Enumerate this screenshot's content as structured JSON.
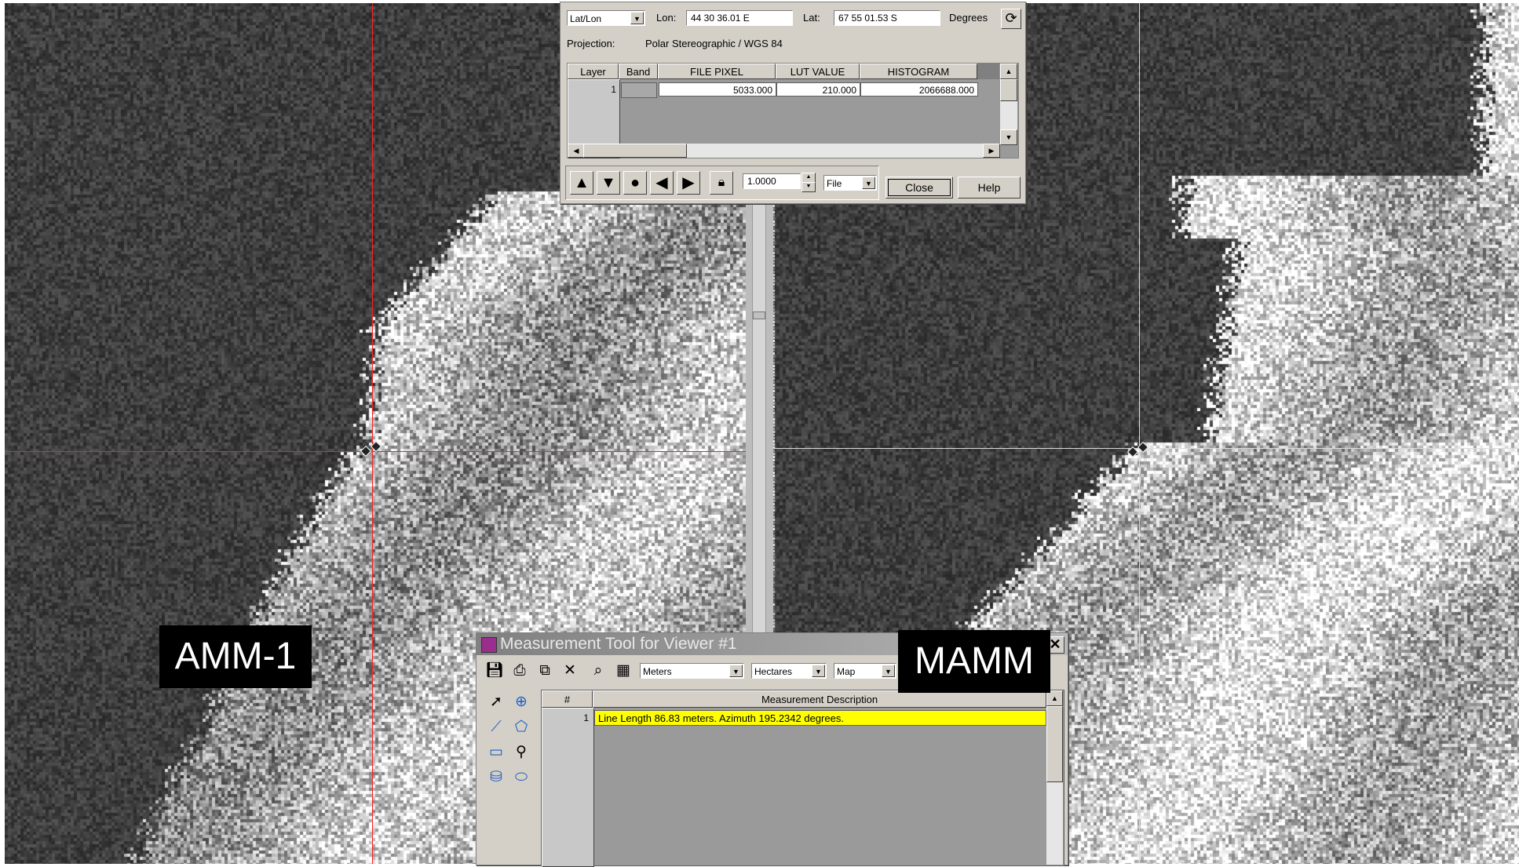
{
  "inquire": {
    "coord_type": "Lat/Lon",
    "lon_label": "Lon:",
    "lon_value": "44 30 36.01 E",
    "lat_label": "Lat:",
    "lat_value": "67 55 01.53 S",
    "units_label": "Degrees",
    "projection_label": "Projection:",
    "projection_value": "Polar Stereographic / WGS 84",
    "columns": [
      "Layer",
      "Band",
      "FILE PIXEL",
      "LUT VALUE",
      "HISTOGRAM"
    ],
    "row": {
      "layer": "1",
      "band": "",
      "file_pixel": "5033.000",
      "lut_value": "210.000",
      "histogram": "2066688.000"
    },
    "step_value": "1.0000",
    "step_unit": "File",
    "close_label": "Close",
    "help_label": "Help"
  },
  "measure": {
    "title": "Measurement Tool for Viewer #1",
    "length_unit": "Meters",
    "area_unit": "Hectares",
    "coord_unit": "Map",
    "col_num": "#",
    "col_desc": "Measurement Description",
    "row_num": "1",
    "row_desc": "Line Length 86.83 meters. Azimuth 195.2342 degrees."
  },
  "labels": {
    "left": "AMM-1",
    "right": "MAMM"
  },
  "icons": {
    "up": "triangle-up-icon",
    "down": "triangle-down-icon",
    "circle": "circle-icon",
    "left": "triangle-left-icon",
    "right": "triangle-right-icon",
    "lock": "lock-icon",
    "refresh": "refresh-icon",
    "close": "close-icon"
  },
  "colors": {
    "left_crosshair": "#ff0000",
    "right_crosshair": "#e0e0e0",
    "highlight_row": "#ffff00"
  }
}
